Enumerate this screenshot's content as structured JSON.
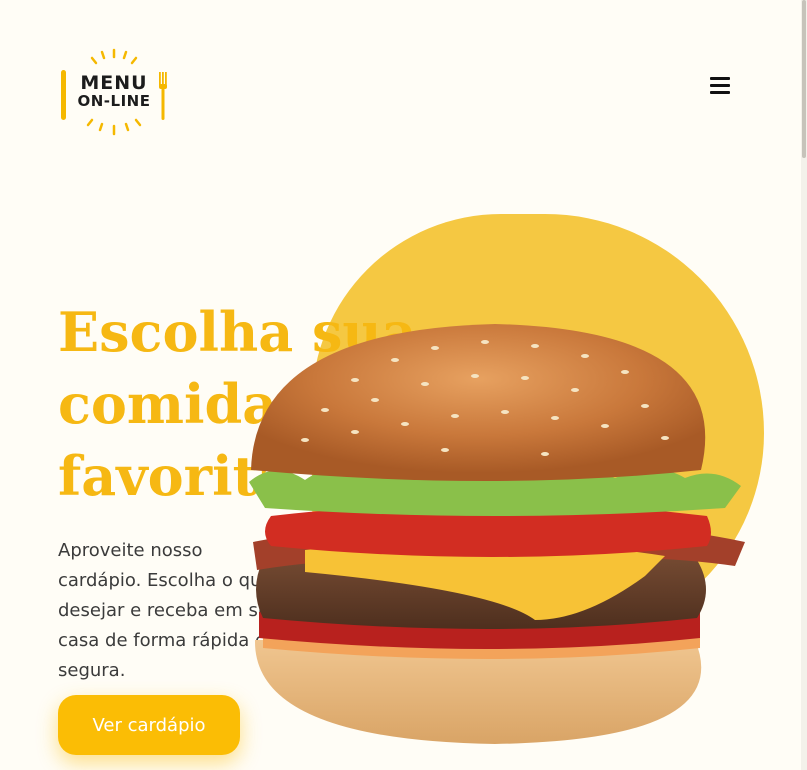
{
  "logo": {
    "line1": "MENU",
    "line2": "ON-LINE"
  },
  "nav": {
    "menu_icon": "hamburger-menu-icon"
  },
  "hero": {
    "title_line1": "Escolha sua",
    "title_line2": "comida",
    "title_line3": "favorita",
    "description": "Aproveite nosso cardápio. Escolha o que desejar e receba em sua casa de forma rápida e segura.",
    "cta_label": "Ver cardápio",
    "image": "hamburger-photo"
  },
  "colors": {
    "background": "#fffdf6",
    "accent": "#fbbd05",
    "title": "#f6b813",
    "blob": "#f5c842",
    "text": "#3b3b3b"
  }
}
